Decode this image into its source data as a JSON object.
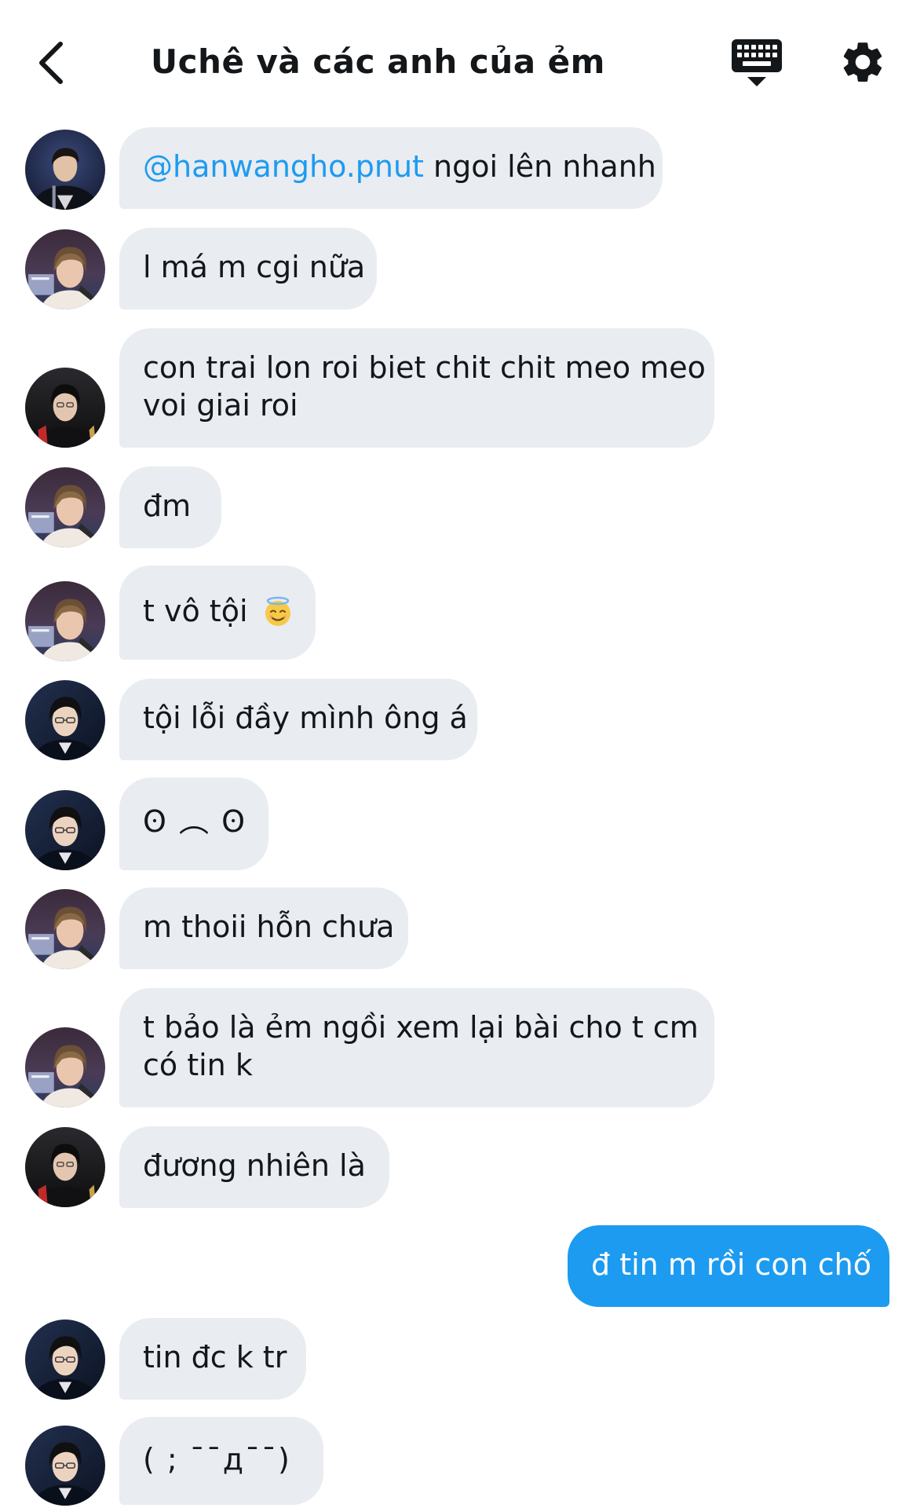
{
  "header": {
    "title": "Uchê và các anh của ẻm",
    "back_icon": "chevron-left-icon",
    "keyboard_icon": "keyboard-icon",
    "settings_icon": "gear-icon"
  },
  "colors": {
    "accent": "#1d9bf0",
    "incoming_bubble": "#e9ecf0",
    "text": "#14171a"
  },
  "messages": [
    {
      "direction": "in",
      "mention": "@hanwangho.pnut",
      "text": " ngoi lên nhanh"
    },
    {
      "direction": "in",
      "text": "l má m cgi nữa"
    },
    {
      "direction": "in",
      "lines": [
        "con trai lon roi biet chit chit meo meo",
        "voi giai roi"
      ]
    },
    {
      "direction": "in",
      "text": "đm"
    },
    {
      "direction": "in",
      "text": "t vô tội",
      "emoji": "😇"
    },
    {
      "direction": "in",
      "text": "tội lỗi đầy mình ông á"
    },
    {
      "direction": "in",
      "text": "ʘ ︵ ʘ"
    },
    {
      "direction": "in",
      "text": "m thoii hỗn chưa"
    },
    {
      "direction": "in",
      "lines": [
        "t bảo là ẻm ngồi xem lại bài cho t cm",
        "có tin k"
      ]
    },
    {
      "direction": "in",
      "text": "đương nhiên là"
    },
    {
      "direction": "out",
      "text": "đ tin m rồi con chố"
    },
    {
      "direction": "in",
      "text": "tin đc k tr"
    },
    {
      "direction": "in",
      "text": "( ; ¯¯д¯¯)"
    }
  ]
}
